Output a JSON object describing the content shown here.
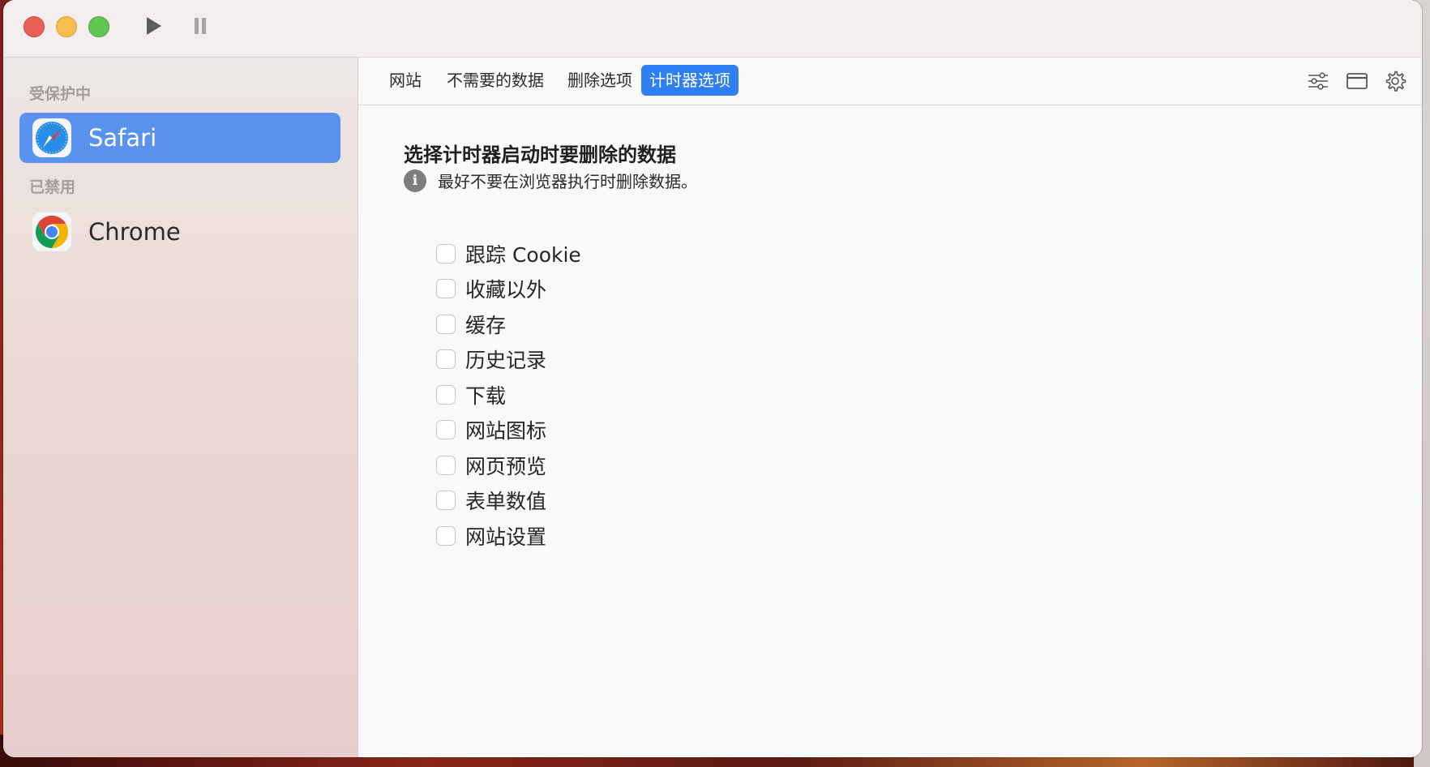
{
  "window": {
    "titlebar": {
      "play_icon": "play-icon",
      "pause_icon": "pause-icon"
    }
  },
  "sidebar": {
    "protected_label": "受保护中",
    "disabled_label": "已禁用",
    "protected_items": [
      {
        "label": "Safari",
        "icon": "safari-icon",
        "selected": true
      }
    ],
    "disabled_items": [
      {
        "label": "Chrome",
        "icon": "chrome-icon",
        "selected": false
      }
    ]
  },
  "toolbar": {
    "tabs": [
      {
        "label": "网站",
        "active": false
      },
      {
        "label": "不需要的数据",
        "active": false
      },
      {
        "label": "删除选项",
        "active": false
      },
      {
        "label": "计时器选项",
        "active": true
      }
    ],
    "icons": [
      "sliders-icon",
      "window-icon",
      "gear-icon"
    ]
  },
  "content": {
    "title": "选择计时器启动时要删除的数据",
    "info_text": "最好不要在浏览器执行时删除数据。",
    "options": [
      {
        "label": "跟踪 Cookie",
        "checked": false
      },
      {
        "label": "收藏以外",
        "checked": false
      },
      {
        "label": "缓存",
        "checked": false
      },
      {
        "label": "历史记录",
        "checked": false
      },
      {
        "label": "下载",
        "checked": false
      },
      {
        "label": "网站图标",
        "checked": false
      },
      {
        "label": "网页预览",
        "checked": false
      },
      {
        "label": "表单数值",
        "checked": false
      },
      {
        "label": "网站设置",
        "checked": false
      }
    ]
  },
  "colors": {
    "accent": "#2f7ef3",
    "sidebar_selected": "#5a93ef",
    "close": "#ec5f59",
    "minimize": "#f4bf4f",
    "maximize": "#61c454"
  }
}
